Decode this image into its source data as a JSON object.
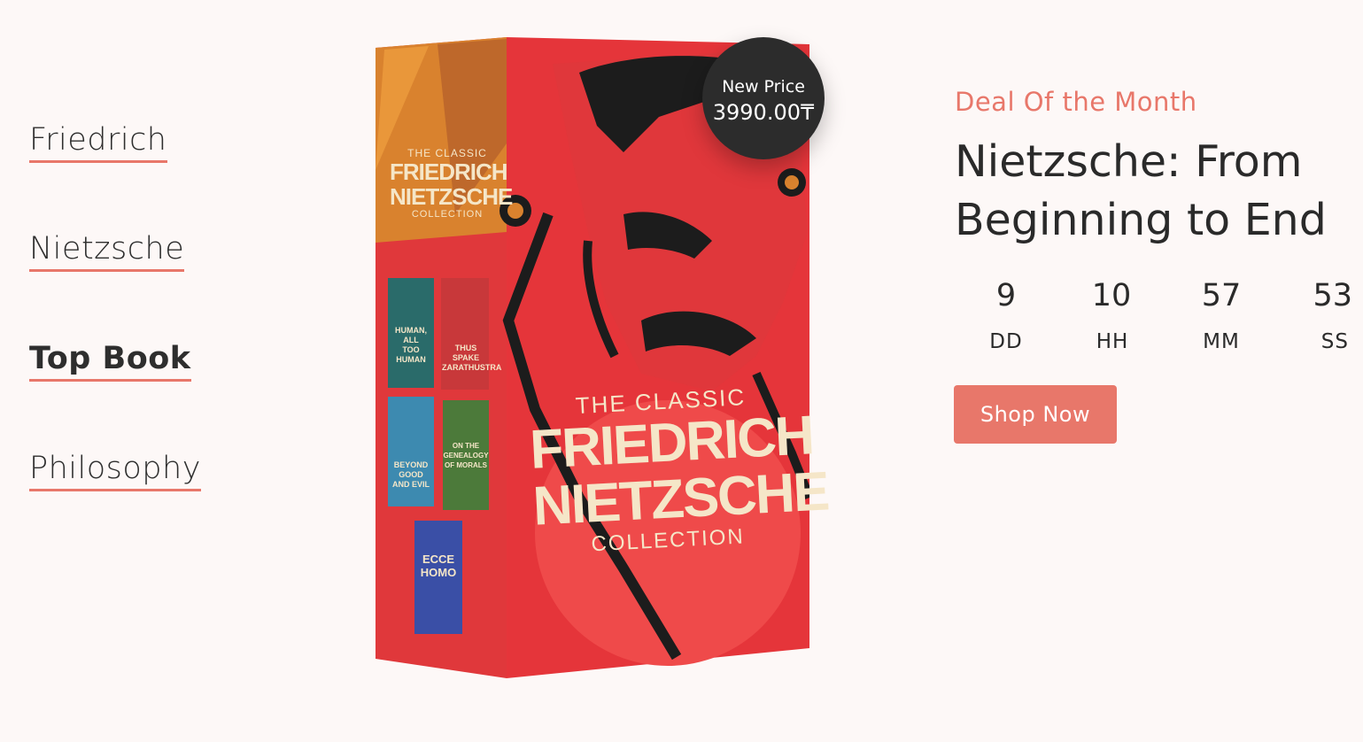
{
  "nav": {
    "items": [
      {
        "label": "Friedrich"
      },
      {
        "label": "Nietzsche"
      },
      {
        "label": "Top Book"
      },
      {
        "label": "Philosophy"
      }
    ]
  },
  "book": {
    "spine_top": "THE CLASSIC",
    "spine_title_1": "FRIEDRICH",
    "spine_title_2": "NIETZSCHE",
    "spine_bottom": "COLLECTION",
    "cover_top": "THE CLASSIC",
    "cover_title_1": "FRIEDRICH",
    "cover_title_2": "NIETZSCHE",
    "cover_bottom": "COLLECTION",
    "mini_books": [
      {
        "title_1": "HUMAN, ALL",
        "title_2": "TOO HUMAN"
      },
      {
        "title_1": "THUS SPAKE",
        "title_2": "ZARATHUSTRA"
      },
      {
        "title_1": "BEYOND GOOD",
        "title_2": "AND EVIL"
      },
      {
        "title_1": "ON THE GENEALOGY",
        "title_2": "OF MORALS"
      },
      {
        "title_1": "ECCE",
        "title_2": "HOMO"
      }
    ]
  },
  "price": {
    "label": "New Price",
    "value": "3990.00₸"
  },
  "deal": {
    "tag": "Deal Of the Month",
    "title_line_1": "Nietzsche: From",
    "title_line_2": "Beginning to End"
  },
  "countdown": {
    "days": "9",
    "days_label": "DD",
    "hours": "10",
    "hours_label": "HH",
    "minutes": "57",
    "minutes_label": "MM",
    "seconds": "53",
    "seconds_label": "SS"
  },
  "cta": {
    "label": "Shop Now"
  },
  "colors": {
    "accent": "#e8776a",
    "book_red": "#e5353a",
    "badge_bg": "#2c2c2c"
  }
}
